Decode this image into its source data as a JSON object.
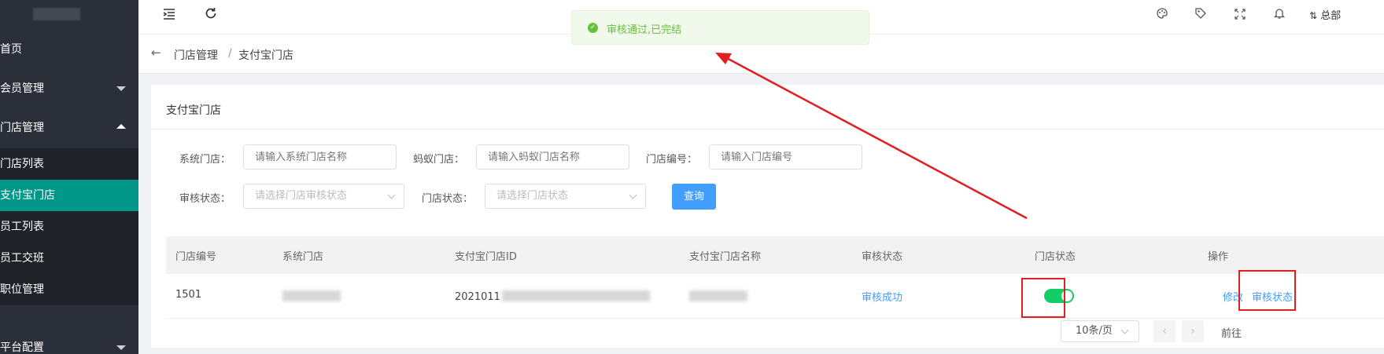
{
  "sidebar": {
    "items": [
      {
        "label": "首页"
      },
      {
        "label": "会员管理"
      },
      {
        "label": "门店管理"
      },
      {
        "label": "门店列表"
      },
      {
        "label": "支付宝门店"
      },
      {
        "label": "员工列表"
      },
      {
        "label": "员工交班"
      },
      {
        "label": "职位管理"
      },
      {
        "label": "平台配置"
      }
    ]
  },
  "header": {
    "user_label": "总部"
  },
  "toast": {
    "message": "审核通过,已完结"
  },
  "breadcrumb": {
    "parent": "门店管理",
    "separator": "/",
    "current": "支付宝门店"
  },
  "card": {
    "title": "支付宝门店"
  },
  "filters": {
    "system_store_label": "系统门店：",
    "system_store_placeholder": "请输入系统门店名称",
    "ant_store_label": "蚂蚁门店：",
    "ant_store_placeholder": "请输入蚂蚁门店名称",
    "store_no_label": "门店编号：",
    "store_no_placeholder": "请输入门店编号",
    "audit_status_label": "审核状态：",
    "audit_status_placeholder": "请选择门店审核状态",
    "store_status_label": "门店状态：",
    "store_status_placeholder": "请选择门店状态",
    "query_label": "查询"
  },
  "table": {
    "columns": [
      "门店编号",
      "系统门店",
      "支付宝门店ID",
      "支付宝门店名称",
      "审核状态",
      "门店状态",
      "操作"
    ],
    "rows": [
      {
        "store_no": "1501",
        "alipay_id": "2021011",
        "audit_status": "审核成功",
        "store_enabled": true,
        "action_edit": "修改",
        "action_audit": "审核状态"
      }
    ]
  },
  "pagination": {
    "page_size": "10条/页",
    "prev_icon": "chevron-left-icon",
    "next_icon": "chevron-right-icon",
    "goto_label": "前往"
  },
  "colors": {
    "sidebar_bg": "#2b2f3a",
    "active_item": "#009688",
    "primary": "#409eff",
    "success": "#67c23a",
    "toggle_on": "#13ce66",
    "annotation_red": "#e02020"
  }
}
